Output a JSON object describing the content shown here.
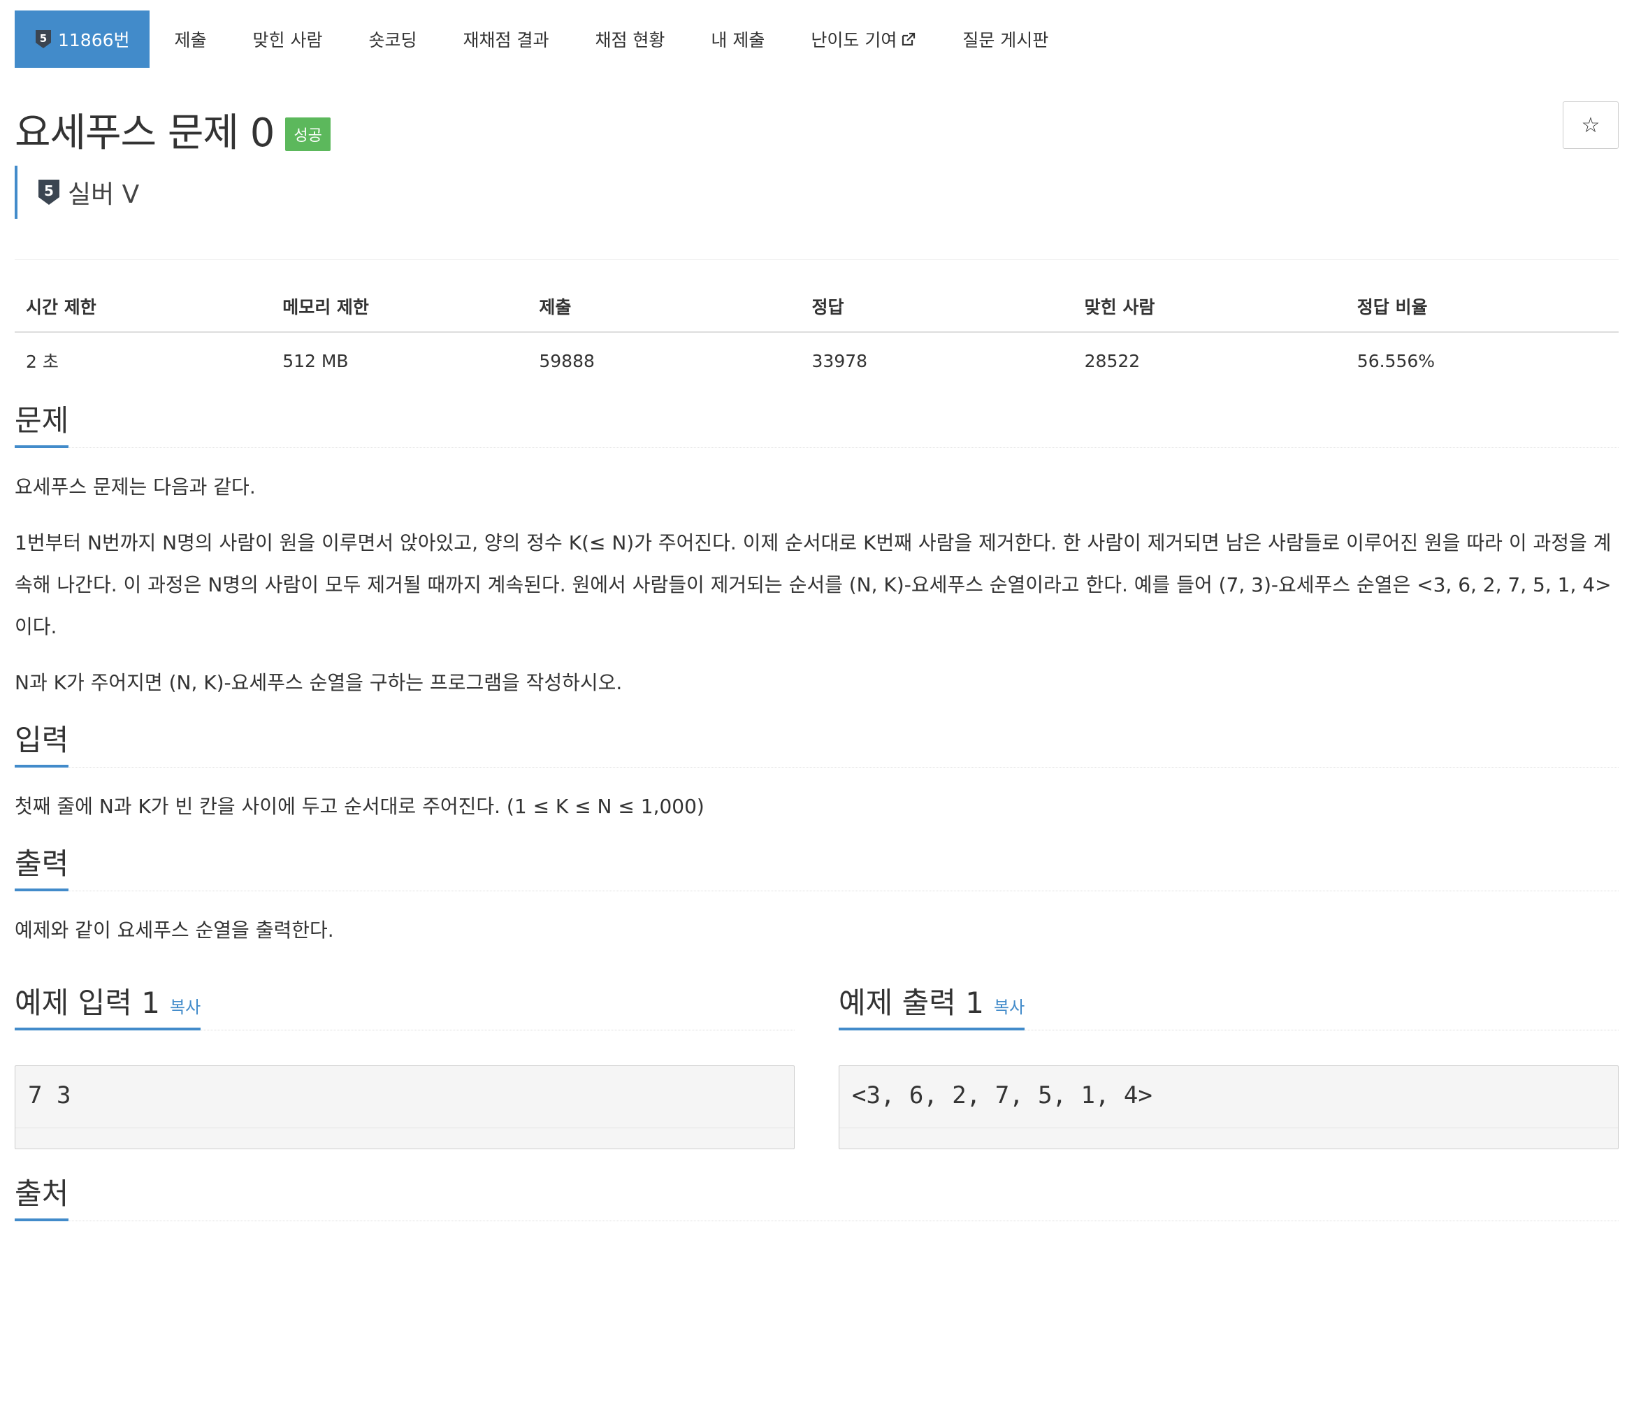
{
  "nav": {
    "tier_badge": "5",
    "items": [
      {
        "label": "11866번",
        "active": true
      },
      {
        "label": "제출"
      },
      {
        "label": "맞힌 사람"
      },
      {
        "label": "숏코딩"
      },
      {
        "label": "재채점 결과"
      },
      {
        "label": "채점 현황"
      },
      {
        "label": "내 제출"
      },
      {
        "label": "난이도 기여"
      },
      {
        "label": "질문 게시판"
      }
    ]
  },
  "problem": {
    "title": "요세푸스 문제 0",
    "status_badge": "성공",
    "star_label": "☆",
    "tier_number": "5",
    "tier_label": "실버 V"
  },
  "stats": {
    "headers": [
      "시간 제한",
      "메모리 제한",
      "제출",
      "정답",
      "맞힌 사람",
      "정답 비율"
    ],
    "values": [
      "2 초",
      "512 MB",
      "59888",
      "33978",
      "28522",
      "56.556%"
    ]
  },
  "sections": {
    "problem": {
      "heading": "문제",
      "paragraphs": [
        "요세푸스 문제는 다음과 같다.",
        "1번부터 N번까지 N명의 사람이 원을 이루면서 앉아있고, 양의 정수 K(≤ N)가 주어진다. 이제 순서대로 K번째 사람을 제거한다. 한 사람이 제거되면 남은 사람들로 이루어진 원을 따라 이 과정을 계속해 나간다. 이 과정은 N명의 사람이 모두 제거될 때까지 계속된다. 원에서 사람들이 제거되는 순서를 (N, K)-요세푸스 순열이라고 한다. 예를 들어 (7, 3)-요세푸스 순열은 <3, 6, 2, 7, 5, 1, 4>이다.",
        "N과 K가 주어지면 (N, K)-요세푸스 순열을 구하는 프로그램을 작성하시오."
      ]
    },
    "input": {
      "heading": "입력",
      "text": "첫째 줄에 N과 K가 빈 칸을 사이에 두고 순서대로 주어진다. (1 ≤ K ≤ N ≤ 1,000)"
    },
    "output": {
      "heading": "출력",
      "text": "예제와 같이 요세푸스 순열을 출력한다."
    },
    "sample_input": {
      "heading": "예제 입력 1",
      "copy_label": "복사",
      "code": "7 3"
    },
    "sample_output": {
      "heading": "예제 출력 1",
      "copy_label": "복사",
      "code": "<3, 6, 2, 7, 5, 1, 4>"
    },
    "source": {
      "heading": "출처"
    }
  },
  "colors": {
    "accent": "#428bca",
    "success": "#5cb85c"
  }
}
